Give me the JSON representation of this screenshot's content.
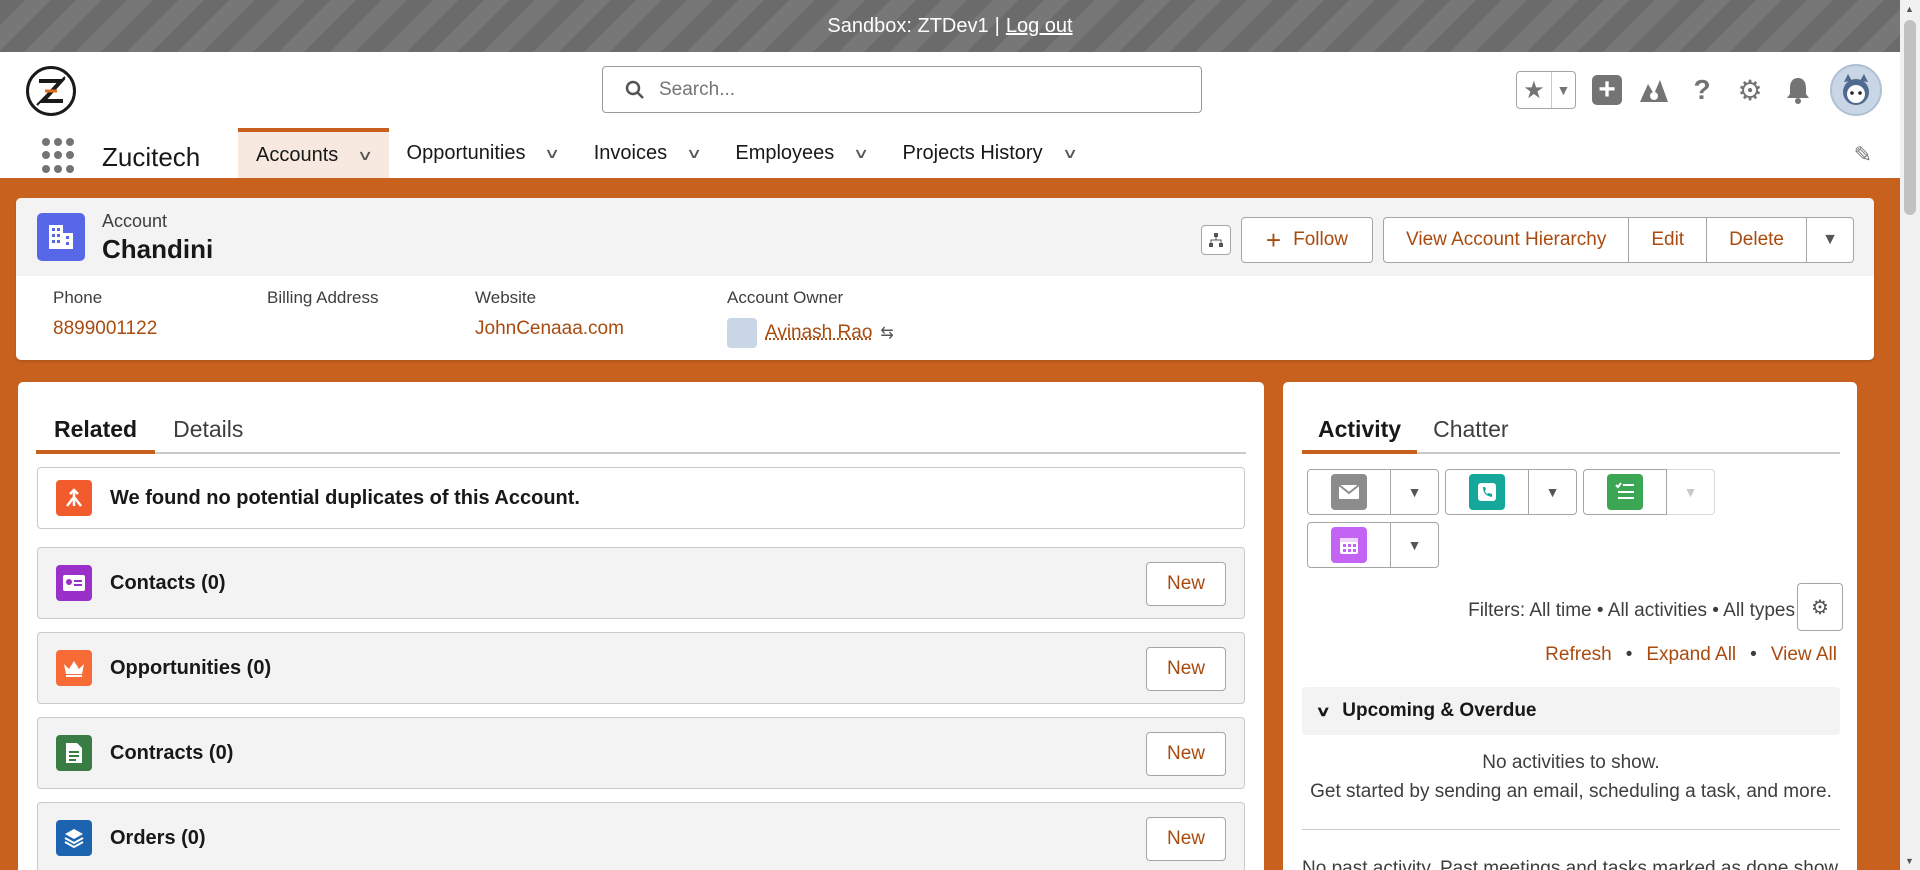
{
  "sandbox": {
    "label": "Sandbox: ZTDev1",
    "separator": "|",
    "logout": "Log out"
  },
  "header": {
    "search_placeholder": "Search...",
    "icons": [
      "star-icon",
      "add-icon",
      "trailhead-icon",
      "help-icon",
      "gear-icon",
      "bell-icon",
      "avatar"
    ]
  },
  "nav": {
    "app_name": "Zucitech",
    "tabs": [
      {
        "label": "Accounts",
        "active": true
      },
      {
        "label": "Opportunities"
      },
      {
        "label": "Invoices"
      },
      {
        "label": "Employees"
      },
      {
        "label": "Projects History"
      }
    ]
  },
  "record": {
    "type": "Account",
    "name": "Chandini",
    "actions": {
      "follow": "Follow",
      "hierarchy": "View Account Hierarchy",
      "edit": "Edit",
      "delete": "Delete"
    },
    "fields": [
      {
        "label": "Phone",
        "value": "8899001122"
      },
      {
        "label": "Billing Address",
        "value": ""
      },
      {
        "label": "Website",
        "value": "JohnCenaaa.com"
      },
      {
        "label": "Account Owner",
        "value": "Avinash Rao"
      }
    ]
  },
  "related": {
    "tabs": [
      "Related",
      "Details"
    ],
    "duplicates": "We found no potential duplicates of this Account.",
    "lists": [
      {
        "title": "Contacts (0)",
        "color": "#9b2fc9",
        "icon": "contact-icon",
        "new": "New"
      },
      {
        "title": "Opportunities (0)",
        "color": "#f76c36",
        "icon": "crown-icon",
        "new": "New"
      },
      {
        "title": "Contracts (0)",
        "color": "#3a7d44",
        "icon": "contract-icon",
        "new": "New"
      },
      {
        "title": "Orders (0)",
        "color": "#1d64b0",
        "icon": "orders-icon",
        "new": "New"
      }
    ]
  },
  "activity": {
    "tabs": [
      "Activity",
      "Chatter"
    ],
    "filters": "Filters: All time • All activities • All types",
    "links": {
      "refresh": "Refresh",
      "expand": "Expand All",
      "view_all": "View All",
      "dot": "•"
    },
    "upcoming": "Upcoming & Overdue",
    "no_activities": "No activities to show.",
    "get_started": "Get started by sending an email, scheduling a task, and more.",
    "past": "No past activity. Past meetings and tasks marked as done show up here.",
    "colors": {
      "email": "#8c8c8c",
      "call": "#14a79a",
      "task": "#3ba755",
      "event": "#c364f5"
    }
  },
  "colors": {
    "brand": "#c9611e",
    "link": "#a94b0f",
    "account_icon": "#5867e8",
    "duplicate_icon": "#f25b2c"
  }
}
